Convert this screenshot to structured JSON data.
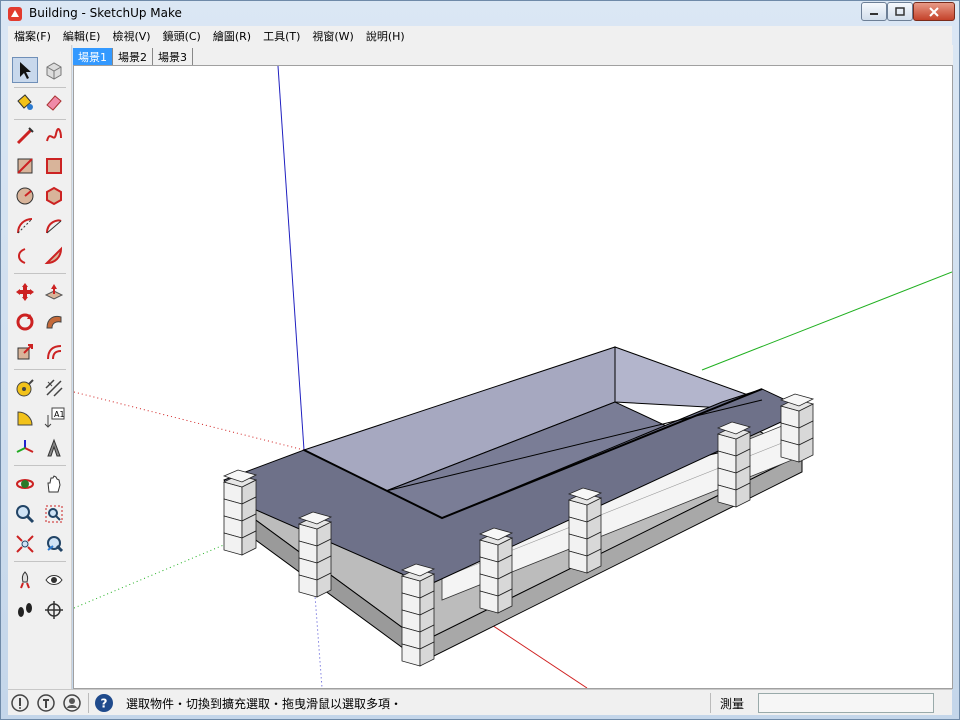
{
  "window": {
    "title": "Building - SketchUp Make",
    "buttons": {
      "minimize": "—",
      "maximize": "□",
      "close": "✕"
    }
  },
  "menu": [
    "檔案(F)",
    "編輯(E)",
    "檢視(V)",
    "鏡頭(C)",
    "繪圖(R)",
    "工具(T)",
    "視窗(W)",
    "說明(H)"
  ],
  "toolbar": {
    "tools": [
      "select-icon",
      "make-component-icon",
      "paint-bucket-icon",
      "eraser-icon",
      "line-icon",
      "freehand-icon",
      "rectangle-icon",
      "rotated-rectangle-icon",
      "circle-icon",
      "polygon-icon",
      "arc-icon",
      "two-point-arc-icon",
      "three-point-arc-icon",
      "pie-icon",
      "move-icon",
      "push-pull-icon",
      "rotate-icon",
      "follow-me-icon",
      "scale-icon",
      "offset-icon",
      "tape-measure-icon",
      "dimension-icon",
      "protractor-icon",
      "text-icon",
      "axes-icon",
      "3d-text-icon",
      "orbit-icon",
      "pan-icon",
      "zoom-icon",
      "zoom-window-icon",
      "zoom-extents-icon",
      "previous-view-icon",
      "position-camera-icon",
      "look-around-icon",
      "walk-icon",
      "section-plane-icon"
    ],
    "text_tool_label": "A1"
  },
  "scenes": [
    "場景1",
    "場景2",
    "場景3"
  ],
  "active_scene": "場景1",
  "status": {
    "message": "選取物件・切換到擴充選取・拖曳滑鼠以選取多項・",
    "measure_label": "測量",
    "measure_value": "",
    "help_symbol": "?"
  },
  "colors": {
    "axis_red": "#d02020",
    "axis_green": "#20b020",
    "axis_blue": "#2020c0",
    "roof": "#6e7189",
    "interior_wall": "#a4a6bf",
    "interior_floor": "#777a92",
    "ground": "#b9b9b9",
    "pillar": "#f0f0f0",
    "selection": "#3399ff"
  }
}
